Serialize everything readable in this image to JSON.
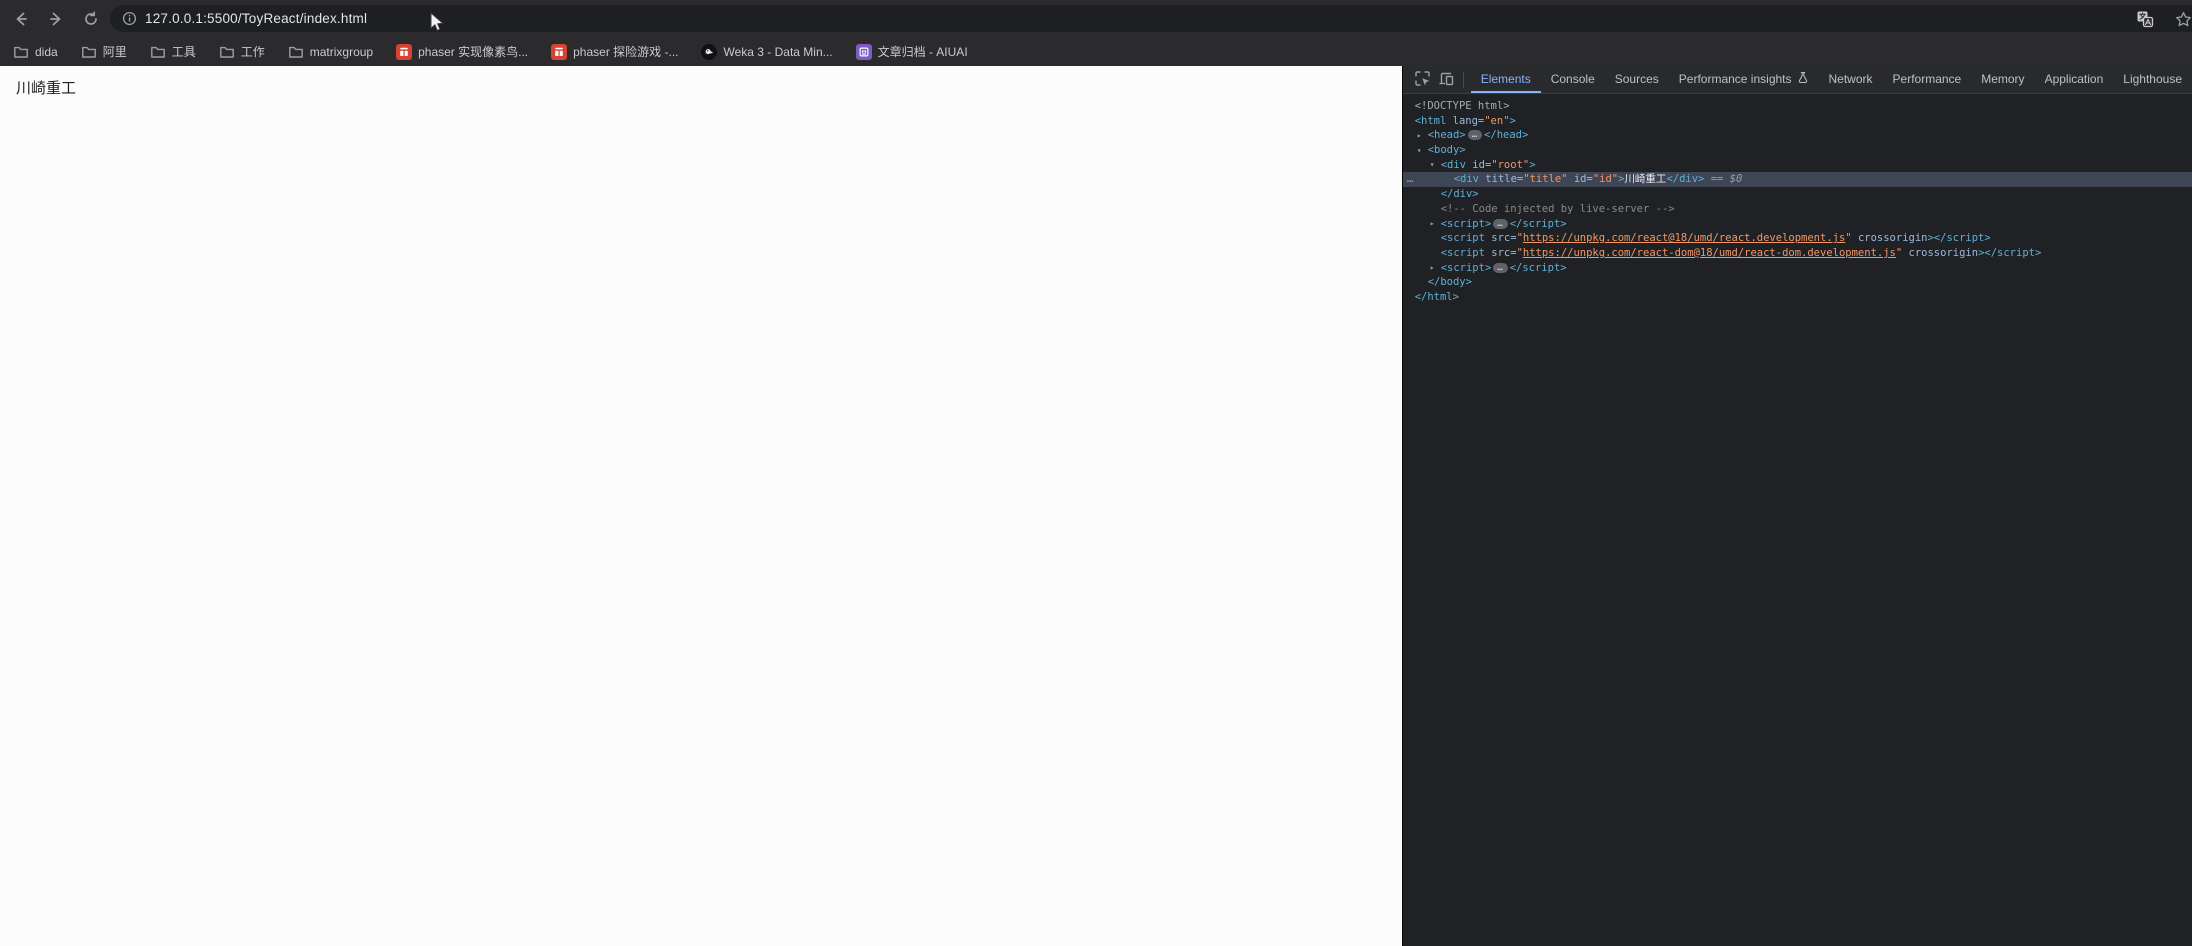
{
  "browser": {
    "toolbar": {
      "url": "127.0.0.1:5500/ToyReact/index.html",
      "back_icon": "back-arrow-icon",
      "forward_icon": "forward-arrow-icon",
      "reload_icon": "reload-icon",
      "site_info_icon": "site-info-icon",
      "translate_icon": "translate-icon",
      "bookmark_star_icon": "bookmark-star-icon"
    },
    "bookmarks": [
      {
        "label": "dida",
        "icon": "folder-icon"
      },
      {
        "label": "阿里",
        "icon": "folder-icon"
      },
      {
        "label": "工具",
        "icon": "folder-icon"
      },
      {
        "label": "工作",
        "icon": "folder-icon"
      },
      {
        "label": "matrixgroup",
        "icon": "folder-icon"
      },
      {
        "label": "phaser 实现像素鸟...",
        "icon": "jianshu-icon"
      },
      {
        "label": "phaser 探险游戏 -...",
        "icon": "jianshu-icon"
      },
      {
        "label": "Weka 3 - Data Min...",
        "icon": "weka-icon"
      },
      {
        "label": "文章归档 - AIUAI",
        "icon": "aiuai-icon"
      }
    ]
  },
  "page": {
    "text": "川崎重工"
  },
  "devtools": {
    "active_tab": "Elements",
    "tabs": [
      {
        "label": "Elements",
        "active": true
      },
      {
        "label": "Console"
      },
      {
        "label": "Sources"
      },
      {
        "label": "Performance insights",
        "icon": "flask-icon"
      },
      {
        "label": "Network"
      },
      {
        "label": "Performance"
      },
      {
        "label": "Memory"
      },
      {
        "label": "Application"
      },
      {
        "label": "Lighthouse"
      }
    ],
    "colors": {
      "accent": "#8ab4f8",
      "tag": "#5db0d7",
      "attribute": "#9bbbdc",
      "value": "#f29766",
      "comment": "#898989",
      "selection_background": "#3e4555"
    },
    "selected_line_suffix": " == $0",
    "code": {
      "lines": [
        {
          "d": 0,
          "t": [
            [
              "doc",
              "<!DOCTYPE html>"
            ]
          ]
        },
        {
          "d": 0,
          "t": [
            [
              "tag",
              "<html"
            ],
            [
              "attr",
              " lang="
            ],
            [
              "val",
              "\"en\""
            ],
            [
              "tag",
              ">"
            ]
          ]
        },
        {
          "d": 1,
          "a": "r",
          "t": [
            [
              "tag",
              "<head>"
            ],
            [
              "ell",
              ""
            ],
            [
              "tag",
              "</head>"
            ]
          ]
        },
        {
          "d": 1,
          "a": "d",
          "t": [
            [
              "tag",
              "<body>"
            ]
          ]
        },
        {
          "d": 2,
          "a": "d",
          "t": [
            [
              "tag",
              "<div"
            ],
            [
              "attr",
              " id="
            ],
            [
              "val",
              "\"root\""
            ],
            [
              "tag",
              ">"
            ]
          ]
        },
        {
          "d": 3,
          "h": true,
          "g": "…",
          "t": [
            [
              "tag",
              "<div"
            ],
            [
              "attr",
              " title="
            ],
            [
              "val",
              "\"title\""
            ],
            [
              "attr",
              " id="
            ],
            [
              "val",
              "\"id\""
            ],
            [
              "tag",
              ">"
            ],
            [
              "text",
              "川崎重工"
            ],
            [
              "tag",
              "</div>"
            ],
            [
              "eq",
              " == $0"
            ]
          ]
        },
        {
          "d": 2,
          "t": [
            [
              "tag",
              "</div>"
            ]
          ]
        },
        {
          "d": 2,
          "t": [
            [
              "com",
              "<!-- Code injected by live-server -->"
            ]
          ]
        },
        {
          "d": 2,
          "a": "r",
          "t": [
            [
              "tag",
              "<script>"
            ],
            [
              "ell",
              ""
            ],
            [
              "tag",
              "</script>"
            ]
          ]
        },
        {
          "d": 2,
          "t": [
            [
              "tag",
              "<script"
            ],
            [
              "attr",
              " src="
            ],
            [
              "val",
              "\""
            ],
            [
              "link",
              "https://unpkg.com/react@18/umd/react.development.js"
            ],
            [
              "val",
              "\""
            ],
            [
              "attr",
              " crossorigin"
            ],
            [
              "tag",
              "></script>"
            ]
          ]
        },
        {
          "d": 2,
          "t": [
            [
              "tag",
              "<script"
            ],
            [
              "attr",
              " src="
            ],
            [
              "val",
              "\""
            ],
            [
              "link",
              "https://unpkg.com/react-dom@18/umd/react-dom.development.js"
            ],
            [
              "val",
              "\""
            ],
            [
              "attr",
              " crossorigin"
            ],
            [
              "tag",
              "></script>"
            ]
          ]
        },
        {
          "d": 2,
          "a": "r",
          "t": [
            [
              "tag",
              "<script>"
            ],
            [
              "ell",
              ""
            ],
            [
              "tag",
              "</script>"
            ]
          ]
        },
        {
          "d": 1,
          "t": [
            [
              "tag",
              "</body>"
            ]
          ]
        },
        {
          "d": 0,
          "t": [
            [
              "tag",
              "</html>"
            ]
          ]
        }
      ]
    }
  }
}
